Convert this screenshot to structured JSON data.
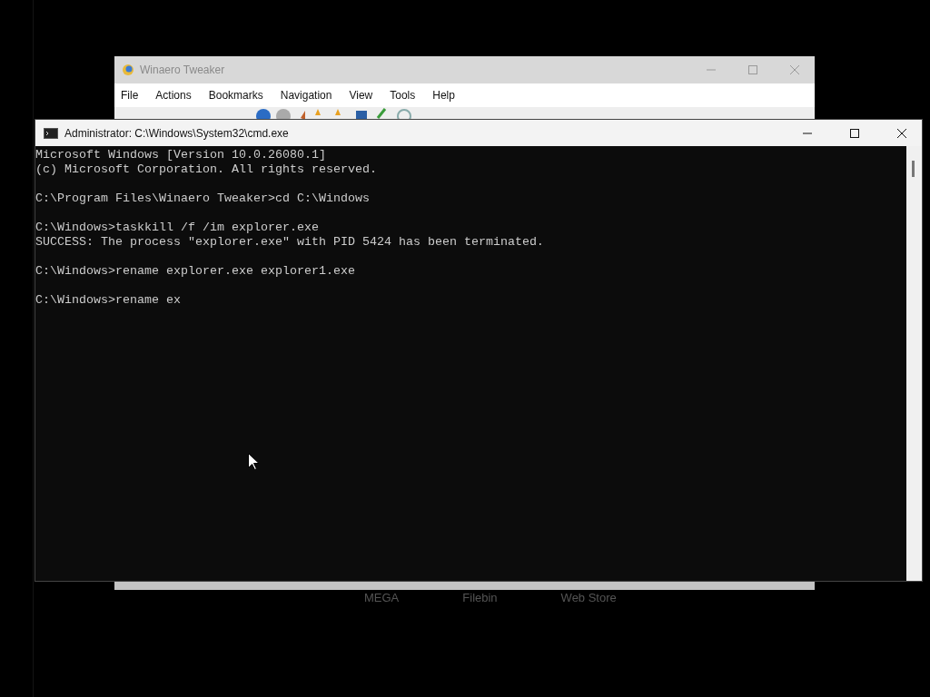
{
  "back_window": {
    "title": "Winaero Tweaker",
    "menu": [
      "File",
      "Actions",
      "Bookmarks",
      "Navigation",
      "View",
      "Tools",
      "Help"
    ]
  },
  "console": {
    "title": "Administrator: C:\\Windows\\System32\\cmd.exe",
    "blocks": [
      [
        "Microsoft Windows [Version 10.0.26080.1]",
        "(c) Microsoft Corporation. All rights reserved."
      ],
      [
        "C:\\Program Files\\Winaero Tweaker>cd C:\\Windows"
      ],
      [
        "C:\\Windows>taskkill /f /im explorer.exe",
        "SUCCESS: The process \"explorer.exe\" with PID 5424 has been terminated."
      ],
      [
        "C:\\Windows>rename explorer.exe explorer1.exe"
      ],
      [
        "C:\\Windows>rename ex"
      ]
    ]
  },
  "below_links": [
    "MEGA",
    "Filebin",
    "Web Store"
  ]
}
